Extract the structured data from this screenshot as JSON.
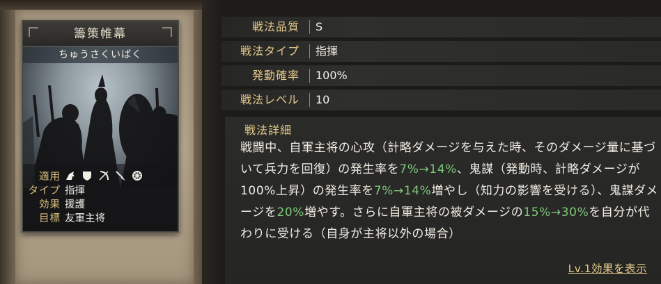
{
  "card": {
    "name": "籌策帷幕",
    "reading": "ちゅうさくいばく",
    "applicable_label": "適用",
    "applicable_icons": [
      "cavalry-icon",
      "shield-icon",
      "bow-icon",
      "spear-icon",
      "siege-icon"
    ],
    "type_label": "タイプ",
    "type_value": "指揮",
    "effect_label": "効果",
    "effect_value": "援護",
    "target_label": "目標",
    "target_value": "友軍主将"
  },
  "stats": [
    {
      "label": "戦法品質",
      "value": "S"
    },
    {
      "label": "戦法タイプ",
      "value": "指揮"
    },
    {
      "label": "発動確率",
      "value": "100%"
    },
    {
      "label": "戦法レベル",
      "value": "10"
    }
  ],
  "detail": {
    "title": "戦法詳細",
    "seg1": "戦闘中、自軍主将の心攻（計略ダメージを与えた時、そのダメージ量に基づいて兵力を回復）の発生率を",
    "seg2": "7%→14%",
    "seg3": "、鬼謀（発動時、計略ダメージが100%上昇）の発生率を",
    "seg4": "7%→14%",
    "seg5": "増やし（知力の影響を受ける）、鬼謀ダメージを",
    "seg6": "20%",
    "seg7": "増やす。さらに自軍主将の被ダメージの",
    "seg8": "15%→30%",
    "seg9": "を自分が代わりに受ける（自身が主将以外の場合）",
    "lv_link": "Lv.1効果を表示"
  },
  "colors": {
    "accent_gold": "#e3c98a",
    "value_green": "#7fc97b"
  }
}
